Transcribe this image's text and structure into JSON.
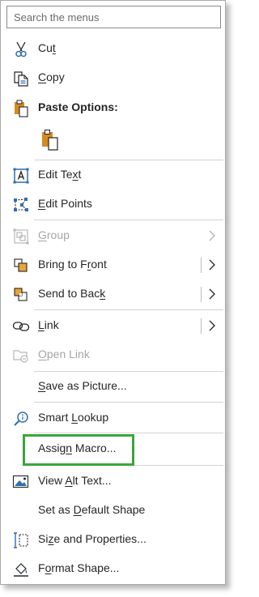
{
  "search": {
    "placeholder": "Search the menus"
  },
  "items": {
    "cut": {
      "pre": "Cu",
      "key": "t",
      "post": ""
    },
    "copy": {
      "pre": "",
      "key": "C",
      "post": "opy"
    },
    "paste_options": {
      "label": "Paste Options:"
    },
    "edit_text": {
      "pre": "Edit Te",
      "key": "x",
      "post": "t"
    },
    "edit_points": {
      "pre": "",
      "key": "E",
      "post": "dit Points"
    },
    "group": {
      "pre": "",
      "key": "G",
      "post": "roup"
    },
    "bring_to_front": {
      "pre": "Bring to F",
      "key": "r",
      "post": "ont"
    },
    "send_to_back": {
      "pre": "Send to Bac",
      "key": "k",
      "post": ""
    },
    "link": {
      "pre": "",
      "key": "L",
      "post": "ink"
    },
    "open_link": {
      "pre": "",
      "key": "O",
      "post": "pen Link"
    },
    "save_as_picture": {
      "pre": "",
      "key": "S",
      "post": "ave as Picture..."
    },
    "smart_lookup": {
      "pre": "Smart ",
      "key": "L",
      "post": "ookup"
    },
    "assign_macro": {
      "pre": "Assig",
      "key": "n",
      "post": " Macro..."
    },
    "view_alt_text": {
      "pre": "View ",
      "key": "A",
      "post": "lt Text..."
    },
    "set_default_shape": {
      "pre": "Set as ",
      "key": "D",
      "post": "efault Shape"
    },
    "size_properties": {
      "pre": "Si",
      "key": "z",
      "post": "e and Properties..."
    },
    "format_shape": {
      "pre": "F",
      "key": "o",
      "post": "rmat Shape..."
    }
  },
  "colors": {
    "icon_blue": "#2f6db3",
    "icon_orange": "#d58a1f",
    "highlight_green": "#3aa63a",
    "disabled_text": "#a6a6a6"
  },
  "icons": [
    "scissors-icon",
    "copy-icon",
    "clipboard-icon",
    "edit-text-icon",
    "edit-points-icon",
    "group-icon",
    "bring-to-front-icon",
    "send-to-back-icon",
    "link-icon",
    "open-link-icon",
    "smart-lookup-icon",
    "alt-text-icon",
    "size-properties-icon",
    "format-shape-icon"
  ]
}
